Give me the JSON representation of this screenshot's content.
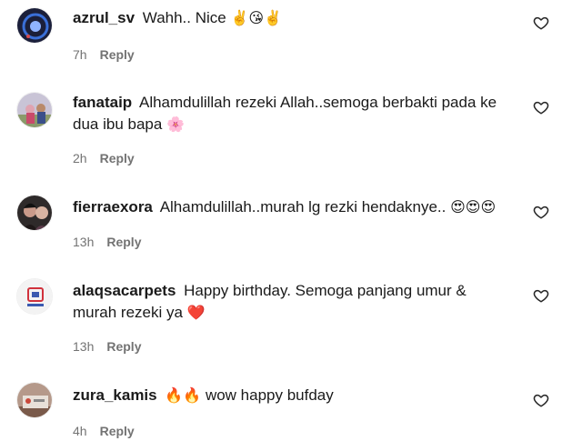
{
  "comments": [
    {
      "username": "azrul_sv",
      "text": "Wahh.. Nice",
      "emoji": "✌️😘✌️",
      "time": "7h",
      "reply": "Reply",
      "avatar": {
        "bg": "#1b1f3a",
        "accent": "#3a6fd8"
      }
    },
    {
      "username": "fanataip",
      "text": "Alhamdulillah rezeki Allah..semoga berbakti pada ke dua ibu bapa",
      "emoji": "🌸",
      "time": "2h",
      "reply": "Reply",
      "avatar": {
        "bg": "#c9c4d6",
        "accent": "#e0a3b0"
      }
    },
    {
      "username": "fierraexora",
      "text": "Alhamdulillah..murah lg rezki hendaknye..",
      "emoji": "😍😍😍",
      "time": "13h",
      "reply": "Reply",
      "avatar": {
        "bg": "#2e2a2a",
        "accent": "#c99a8a"
      }
    },
    {
      "username": "alaqsacarpets",
      "text": "Happy birthday. Semoga panjang umur & murah rezeki ya",
      "emoji": "❤️",
      "time": "13h",
      "reply": "Reply",
      "avatar": {
        "bg": "#f3f3f3",
        "accent": "#d1323c"
      }
    },
    {
      "username": "zura_kamis",
      "text": "wow happy bufday",
      "emoji_before": "🔥🔥",
      "time": "4h",
      "reply": "Reply",
      "avatar": {
        "bg": "#b5998a",
        "accent": "#d9c3b3"
      }
    }
  ],
  "like_icon": "heart-outline-icon"
}
